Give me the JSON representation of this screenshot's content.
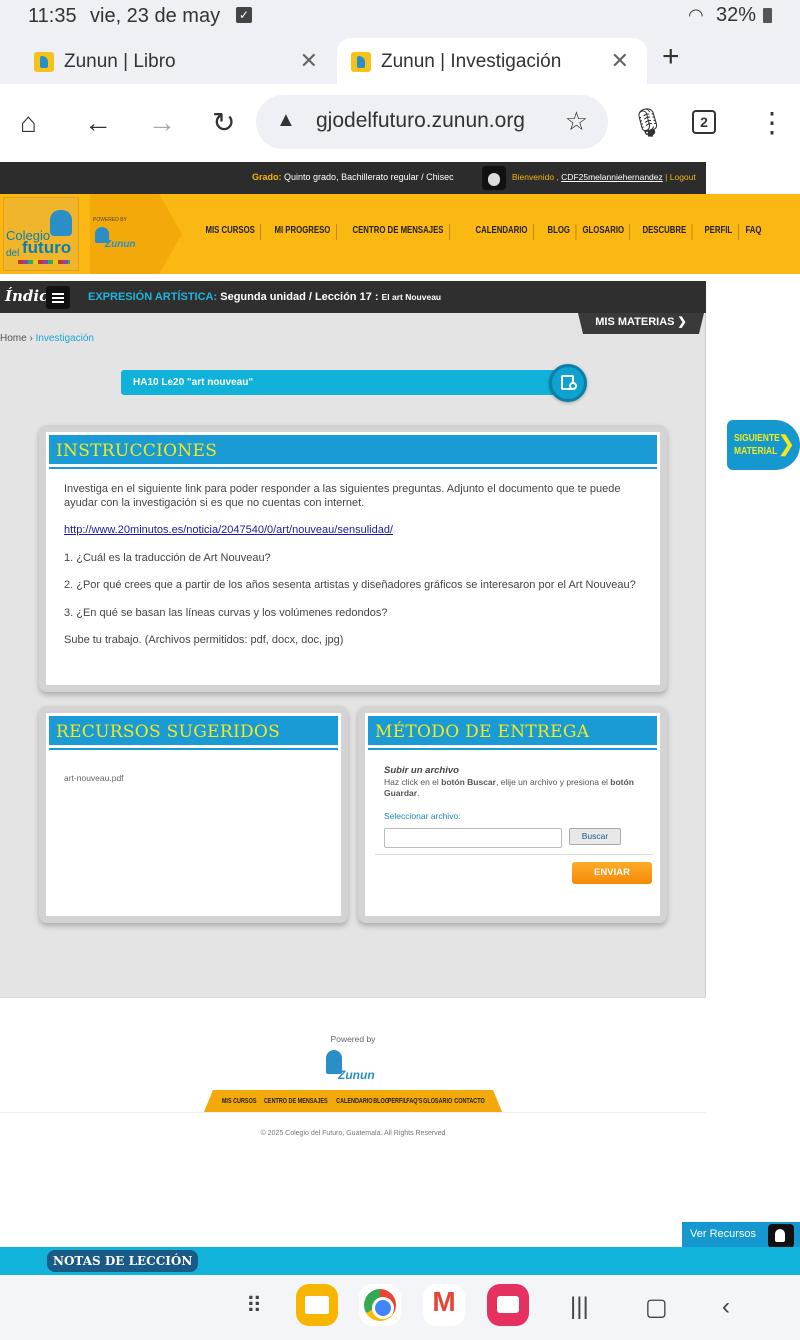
{
  "status_bar": {
    "time": "11:35",
    "date": "vie, 23 de may",
    "battery": "32%"
  },
  "browser": {
    "tabs": [
      {
        "title": "Zunun | Libro",
        "active": false
      },
      {
        "title": "Zunun | Investigación",
        "active": true
      }
    ],
    "url": "gjodelfuturo.zunun.org",
    "tab_count": "2"
  },
  "site": {
    "top_bar": {
      "grado_label": "Grado:",
      "grado_value": "Quinto grado, Bachillerato regular / Chisec",
      "bienvenido": "Bienvenido ,",
      "username": "CDF25melanniehernandez",
      "separator": "|",
      "logout": "Logout"
    },
    "logo": {
      "line1": "Colegio",
      "line2": "del",
      "line3": "futuro"
    },
    "powered_by_small": "POWERED BY",
    "brand": "Zunun",
    "nav": [
      "MIS CURSOS",
      "MI PROGRESO",
      "CENTRO DE MENSAJES",
      "CALENDARIO",
      "BLOG",
      "GLOSARIO",
      "DESCUBRE",
      "PERFIL",
      "FAQ"
    ],
    "lesson_bar": {
      "indice": "Índice",
      "subject": "EXPRESIÓN ARTÍSTICA:",
      "unit": "Segunda unidad / Lección 17 :",
      "lesson": "El art Nouveau"
    },
    "mis_materias": "MIS MATERIAS ❯",
    "breadcrumb": {
      "home": "Home",
      "sep": "›",
      "current": "Investigación"
    },
    "search_value": "HA10 Le20 \"art nouveau\"",
    "instrucciones": {
      "title": "INSTRUCCIONES",
      "intro": "Investiga en el siguiente link para poder responder a las siguientes preguntas. Adjunto el documento que te puede ayudar con la investigación si es que no cuentas con internet.",
      "link": "http://www.20minutos.es/noticia/2047540/0/art/nouveau/sensulidad/",
      "q1": "1. ¿Cuál es la traducción de Art Nouveau?",
      "q2": "2. ¿Por qué crees que a partir de los años sesenta artistas y diseñadores gráficos se interesaron por el Art Nouveau?",
      "q3": "3. ¿En qué se basan las líneas curvas y los volúmenes redondos?",
      "upload_note": "Sube tu trabajo. (Archivos permitidos: pdf, docx, doc, jpg)"
    },
    "recursos": {
      "title": "RECURSOS SUGERIDOS",
      "file": "art-nouveau.pdf"
    },
    "metodo": {
      "title": "MÉTODO DE ENTREGA",
      "subtitle": "Subir un archivo",
      "help_1": "Haz click en el ",
      "help_b1": "botón Buscar",
      "help_2": ", elije un archivo y presiona el ",
      "help_b2": "botón Guardar",
      "help_3": ".",
      "select_label": "Seleccionar archivo:",
      "browse": "Buscar",
      "submit": "ENVIAR"
    },
    "siguiente": {
      "line1": "SIGUIENTE",
      "line2": "MATERIAL"
    },
    "footer": {
      "powered_by": "Powered by",
      "menu": [
        "MIS CURSOS",
        "CENTRO DE MENSAJES",
        "CALENDARIO",
        "BLOG",
        "PERFIL",
        "FAQ'S",
        "GLOSARIO",
        "CONTACTO"
      ],
      "copyright": "© 2025 Colegio del Futuro, Guatemala. All Rights Reserved"
    },
    "ver_recursos": "Ver Recursos",
    "notas": "NOTAS DE LECCIÓN"
  }
}
